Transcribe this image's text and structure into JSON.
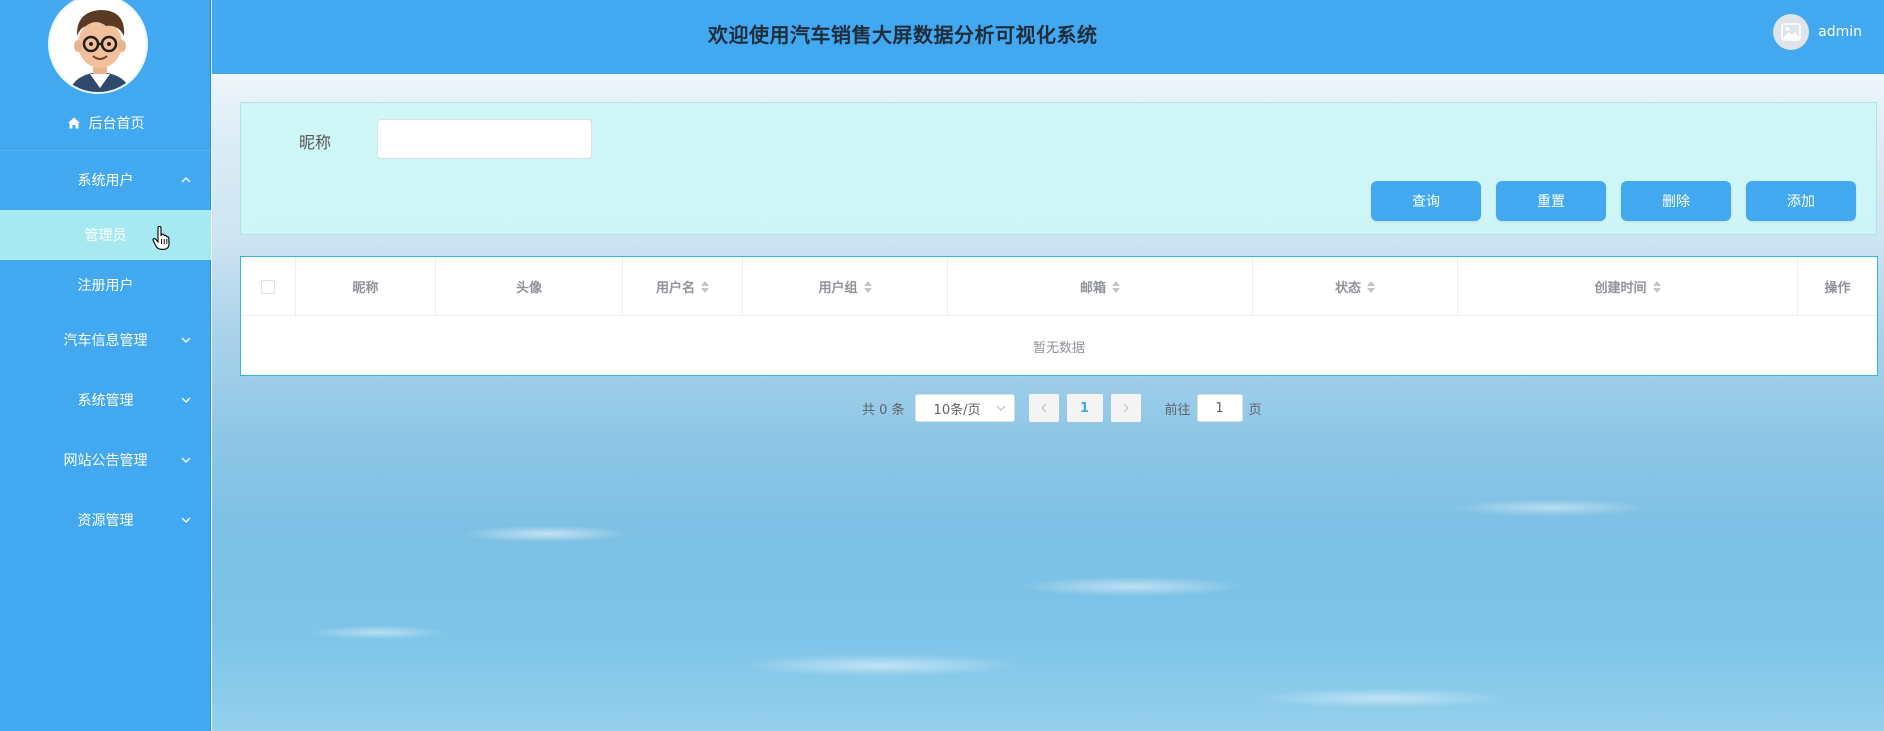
{
  "header": {
    "title": "欢迎使用汽车销售大屏数据分析可视化系统",
    "user": "admin"
  },
  "sidebar": {
    "items": [
      {
        "label": "后台首页",
        "icon": "home-icon"
      },
      {
        "label": "系统用户",
        "expanded": true
      },
      {
        "label": "管理员",
        "active": true
      },
      {
        "label": "注册用户"
      },
      {
        "label": "汽车信息管理"
      },
      {
        "label": "系统管理"
      },
      {
        "label": "网站公告管理"
      },
      {
        "label": "资源管理"
      }
    ]
  },
  "search": {
    "label": "昵称",
    "value": "",
    "placeholder": ""
  },
  "buttons": {
    "query": "查询",
    "reset": "重置",
    "delete": "删除",
    "add": "添加"
  },
  "table": {
    "columns": [
      "昵称",
      "头像",
      "用户名",
      "用户组",
      "邮箱",
      "状态",
      "创建时间",
      "操作"
    ],
    "empty_text": "暂无数据"
  },
  "pagination": {
    "total": "共 0 条",
    "page_size": "10条/页",
    "current_page": "1",
    "goto_label": "前往",
    "goto_value": "1",
    "goto_suffix": "页"
  },
  "colors": {
    "primary": "#42a8ef",
    "active_menu": "#a6e9f1",
    "panel_bg": "#cdf7f7"
  }
}
